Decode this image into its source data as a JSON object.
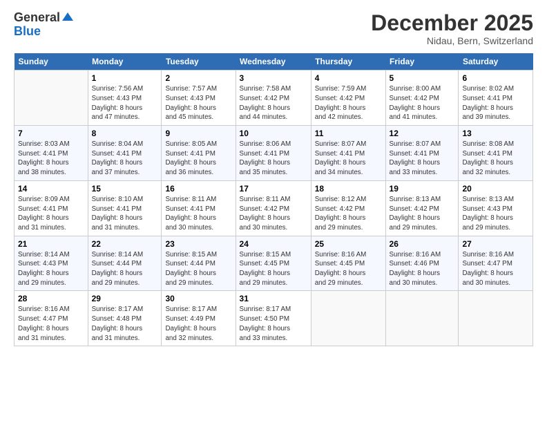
{
  "logo": {
    "general": "General",
    "blue": "Blue"
  },
  "title": "December 2025",
  "subtitle": "Nidau, Bern, Switzerland",
  "days_header": [
    "Sunday",
    "Monday",
    "Tuesday",
    "Wednesday",
    "Thursday",
    "Friday",
    "Saturday"
  ],
  "weeks": [
    [
      {
        "day": "",
        "info": ""
      },
      {
        "day": "1",
        "info": "Sunrise: 7:56 AM\nSunset: 4:43 PM\nDaylight: 8 hours\nand 47 minutes."
      },
      {
        "day": "2",
        "info": "Sunrise: 7:57 AM\nSunset: 4:43 PM\nDaylight: 8 hours\nand 45 minutes."
      },
      {
        "day": "3",
        "info": "Sunrise: 7:58 AM\nSunset: 4:42 PM\nDaylight: 8 hours\nand 44 minutes."
      },
      {
        "day": "4",
        "info": "Sunrise: 7:59 AM\nSunset: 4:42 PM\nDaylight: 8 hours\nand 42 minutes."
      },
      {
        "day": "5",
        "info": "Sunrise: 8:00 AM\nSunset: 4:42 PM\nDaylight: 8 hours\nand 41 minutes."
      },
      {
        "day": "6",
        "info": "Sunrise: 8:02 AM\nSunset: 4:41 PM\nDaylight: 8 hours\nand 39 minutes."
      }
    ],
    [
      {
        "day": "7",
        "info": "Sunrise: 8:03 AM\nSunset: 4:41 PM\nDaylight: 8 hours\nand 38 minutes."
      },
      {
        "day": "8",
        "info": "Sunrise: 8:04 AM\nSunset: 4:41 PM\nDaylight: 8 hours\nand 37 minutes."
      },
      {
        "day": "9",
        "info": "Sunrise: 8:05 AM\nSunset: 4:41 PM\nDaylight: 8 hours\nand 36 minutes."
      },
      {
        "day": "10",
        "info": "Sunrise: 8:06 AM\nSunset: 4:41 PM\nDaylight: 8 hours\nand 35 minutes."
      },
      {
        "day": "11",
        "info": "Sunrise: 8:07 AM\nSunset: 4:41 PM\nDaylight: 8 hours\nand 34 minutes."
      },
      {
        "day": "12",
        "info": "Sunrise: 8:07 AM\nSunset: 4:41 PM\nDaylight: 8 hours\nand 33 minutes."
      },
      {
        "day": "13",
        "info": "Sunrise: 8:08 AM\nSunset: 4:41 PM\nDaylight: 8 hours\nand 32 minutes."
      }
    ],
    [
      {
        "day": "14",
        "info": "Sunrise: 8:09 AM\nSunset: 4:41 PM\nDaylight: 8 hours\nand 31 minutes."
      },
      {
        "day": "15",
        "info": "Sunrise: 8:10 AM\nSunset: 4:41 PM\nDaylight: 8 hours\nand 31 minutes."
      },
      {
        "day": "16",
        "info": "Sunrise: 8:11 AM\nSunset: 4:41 PM\nDaylight: 8 hours\nand 30 minutes."
      },
      {
        "day": "17",
        "info": "Sunrise: 8:11 AM\nSunset: 4:42 PM\nDaylight: 8 hours\nand 30 minutes."
      },
      {
        "day": "18",
        "info": "Sunrise: 8:12 AM\nSunset: 4:42 PM\nDaylight: 8 hours\nand 29 minutes."
      },
      {
        "day": "19",
        "info": "Sunrise: 8:13 AM\nSunset: 4:42 PM\nDaylight: 8 hours\nand 29 minutes."
      },
      {
        "day": "20",
        "info": "Sunrise: 8:13 AM\nSunset: 4:43 PM\nDaylight: 8 hours\nand 29 minutes."
      }
    ],
    [
      {
        "day": "21",
        "info": "Sunrise: 8:14 AM\nSunset: 4:43 PM\nDaylight: 8 hours\nand 29 minutes."
      },
      {
        "day": "22",
        "info": "Sunrise: 8:14 AM\nSunset: 4:44 PM\nDaylight: 8 hours\nand 29 minutes."
      },
      {
        "day": "23",
        "info": "Sunrise: 8:15 AM\nSunset: 4:44 PM\nDaylight: 8 hours\nand 29 minutes."
      },
      {
        "day": "24",
        "info": "Sunrise: 8:15 AM\nSunset: 4:45 PM\nDaylight: 8 hours\nand 29 minutes."
      },
      {
        "day": "25",
        "info": "Sunrise: 8:16 AM\nSunset: 4:45 PM\nDaylight: 8 hours\nand 29 minutes."
      },
      {
        "day": "26",
        "info": "Sunrise: 8:16 AM\nSunset: 4:46 PM\nDaylight: 8 hours\nand 30 minutes."
      },
      {
        "day": "27",
        "info": "Sunrise: 8:16 AM\nSunset: 4:47 PM\nDaylight: 8 hours\nand 30 minutes."
      }
    ],
    [
      {
        "day": "28",
        "info": "Sunrise: 8:16 AM\nSunset: 4:47 PM\nDaylight: 8 hours\nand 31 minutes."
      },
      {
        "day": "29",
        "info": "Sunrise: 8:17 AM\nSunset: 4:48 PM\nDaylight: 8 hours\nand 31 minutes."
      },
      {
        "day": "30",
        "info": "Sunrise: 8:17 AM\nSunset: 4:49 PM\nDaylight: 8 hours\nand 32 minutes."
      },
      {
        "day": "31",
        "info": "Sunrise: 8:17 AM\nSunset: 4:50 PM\nDaylight: 8 hours\nand 33 minutes."
      },
      {
        "day": "",
        "info": ""
      },
      {
        "day": "",
        "info": ""
      },
      {
        "day": "",
        "info": ""
      }
    ]
  ]
}
